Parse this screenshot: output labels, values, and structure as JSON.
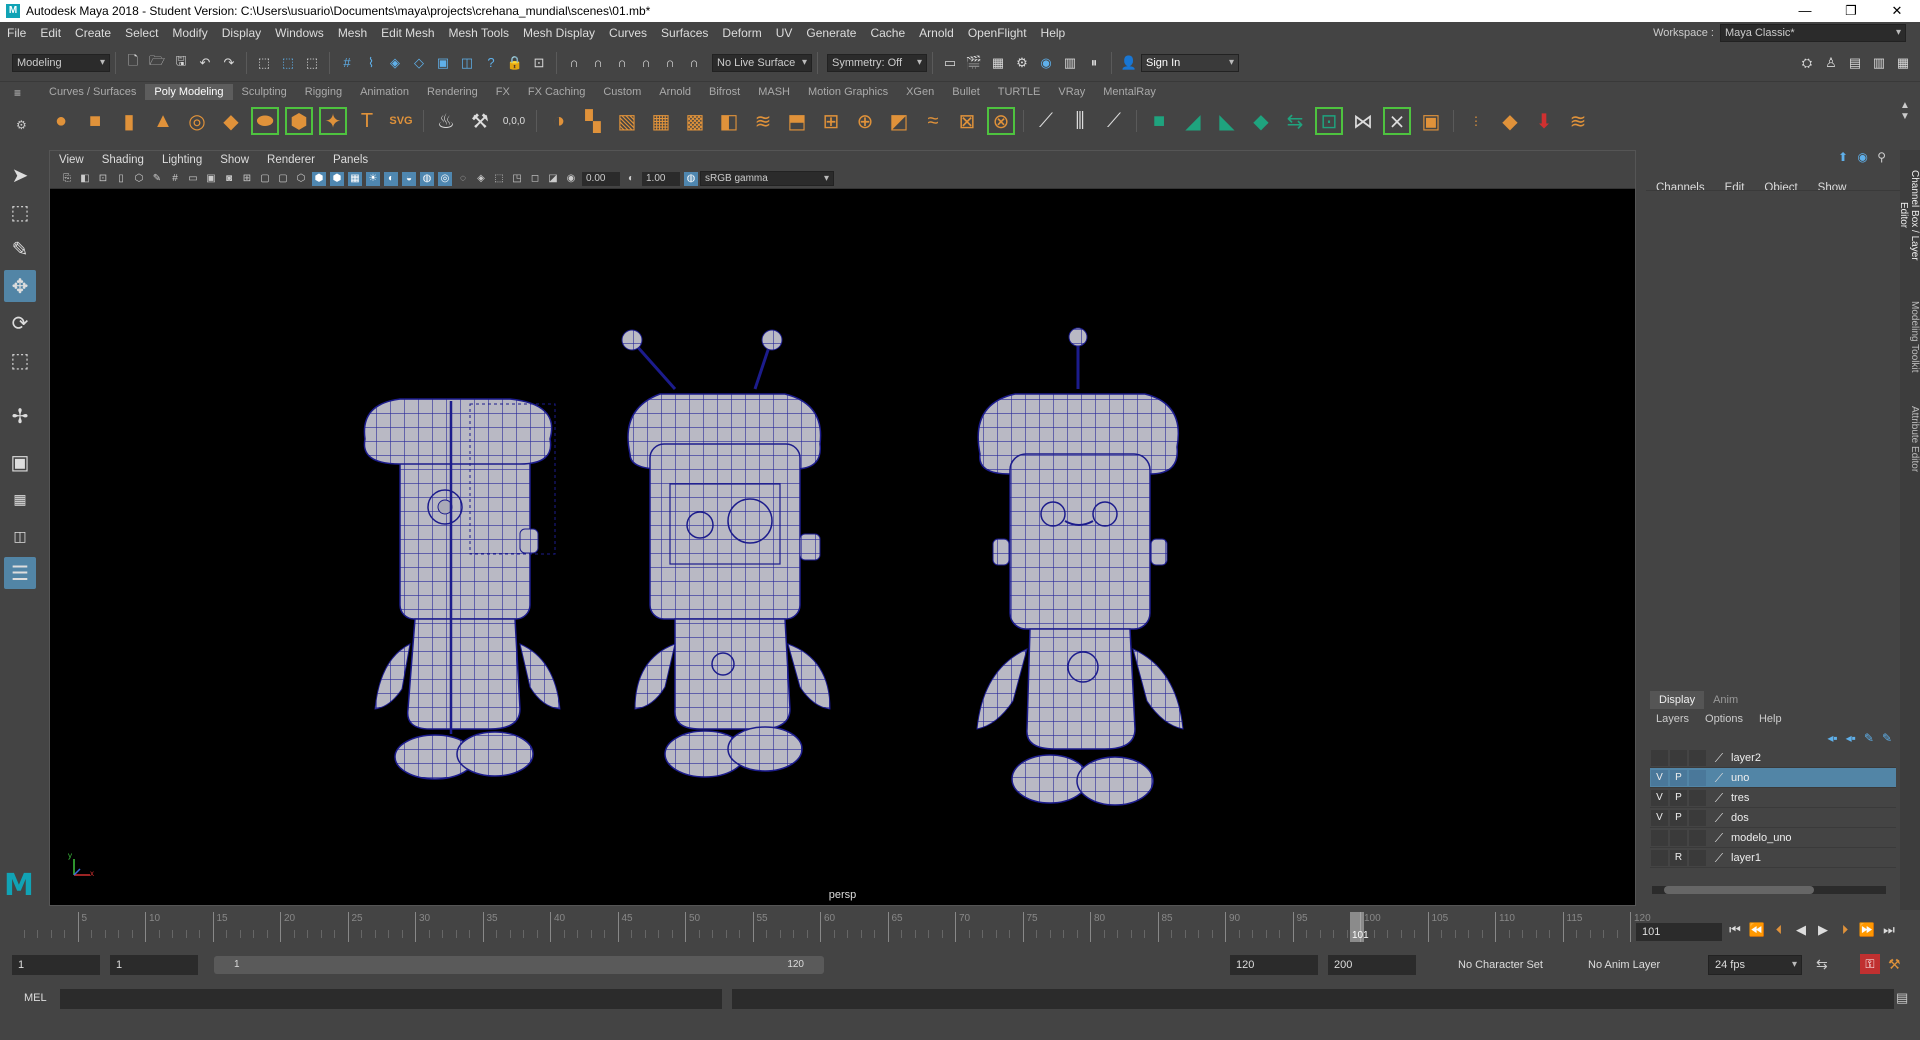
{
  "title_bar": {
    "app_title": "Autodesk Maya 2018 - Student Version: C:\\Users\\usuario\\Documents\\maya\\projects\\crehana_mundial\\scenes\\01.mb*"
  },
  "menu_bar": {
    "items": [
      "File",
      "Edit",
      "Create",
      "Select",
      "Modify",
      "Display",
      "Windows",
      "Mesh",
      "Edit Mesh",
      "Mesh Tools",
      "Mesh Display",
      "Curves",
      "Surfaces",
      "Deform",
      "UV",
      "Generate",
      "Cache",
      "Arnold",
      "OpenFlight",
      "Help"
    ],
    "workspace_label": "Workspace :",
    "workspace_value": "Maya Classic*"
  },
  "status_line": {
    "menu_set": "Modeling",
    "live_surface": "No Live Surface",
    "symmetry": "Symmetry: Off",
    "sign_in": "Sign In"
  },
  "shelf": {
    "tabs": [
      "Curves / Surfaces",
      "Poly Modeling",
      "Sculpting",
      "Rigging",
      "Animation",
      "Rendering",
      "FX",
      "FX Caching",
      "Custom",
      "Arnold",
      "Bifrost",
      "MASH",
      "Motion Graphics",
      "XGen",
      "Bullet",
      "TURTLE",
      "VRay",
      "MentalRay"
    ],
    "active_tab": "Poly Modeling"
  },
  "viewport": {
    "menus": [
      "View",
      "Shading",
      "Lighting",
      "Show",
      "Renderer",
      "Panels"
    ],
    "exposure": "0.00",
    "gamma": "1.00",
    "color_space": "sRGB gamma",
    "camera_label": "persp",
    "axis_x": "x",
    "axis_y": "y"
  },
  "channel_box": {
    "menus": [
      "Channels",
      "Edit",
      "Object",
      "Show"
    ],
    "side_tabs": [
      "Channel Box / Layer Editor",
      "Modeling Toolkit",
      "Attribute Editor"
    ]
  },
  "layer_editor": {
    "tabs": [
      "Display",
      "Anim"
    ],
    "active_tab": "Display",
    "menus": [
      "Layers",
      "Options",
      "Help"
    ],
    "layers": [
      {
        "v": "",
        "p": "",
        "name": "layer2",
        "selected": false
      },
      {
        "v": "V",
        "p": "P",
        "name": "uno",
        "selected": true
      },
      {
        "v": "V",
        "p": "P",
        "name": "tres",
        "selected": false
      },
      {
        "v": "V",
        "p": "P",
        "name": "dos",
        "selected": false
      },
      {
        "v": "",
        "p": "",
        "name": "modelo_uno",
        "selected": false
      },
      {
        "v": "",
        "p": "R",
        "name": "layer1",
        "selected": false
      }
    ]
  },
  "time_slider": {
    "ticks": [
      "5",
      "10",
      "15",
      "20",
      "25",
      "30",
      "35",
      "40",
      "45",
      "50",
      "55",
      "60",
      "65",
      "70",
      "75",
      "80",
      "85",
      "90",
      "95",
      "100",
      "105",
      "110",
      "115",
      "120"
    ],
    "current_frame_marker": "101",
    "current_frame": "101"
  },
  "range_slider": {
    "start_time": "1",
    "playback_start": "1",
    "range_start_label": "1",
    "range_end_label": "120",
    "playback_end": "120",
    "end_time": "200",
    "character_set": "No Character Set",
    "anim_layer": "No Anim Layer",
    "fps": "24 fps"
  },
  "command_line": {
    "mode": "MEL"
  },
  "colors": {
    "accent_blue": "#5285a6",
    "shelf_orange": "#e0923a",
    "shelf_green": "#1fa37e",
    "maya_cyan": "#11a3b5",
    "wire_blue": "#1c1c8c"
  }
}
